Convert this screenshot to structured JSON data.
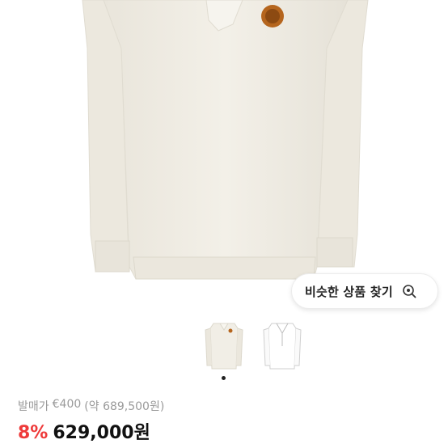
{
  "similar_button": {
    "label": "비슷한 상품 찾기",
    "icon": "search-sparkle-icon"
  },
  "gallery": {
    "thumbnails": [
      {
        "name": "cream-long-sleeve-polo",
        "color": "#f1eee6"
      },
      {
        "name": "white-long-sleeve-polo",
        "color": "#ffffff"
      }
    ],
    "pagination_dots": 1,
    "active_index": 0
  },
  "pricing": {
    "retail_label": "발매가",
    "retail_price": "€400",
    "retail_converted": "(약 689,500원)",
    "discount": "8%",
    "price": "629,000원"
  },
  "colors": {
    "discount": "#ee3a3a",
    "garment": "#f1eee6",
    "patch": "#b5651d"
  }
}
